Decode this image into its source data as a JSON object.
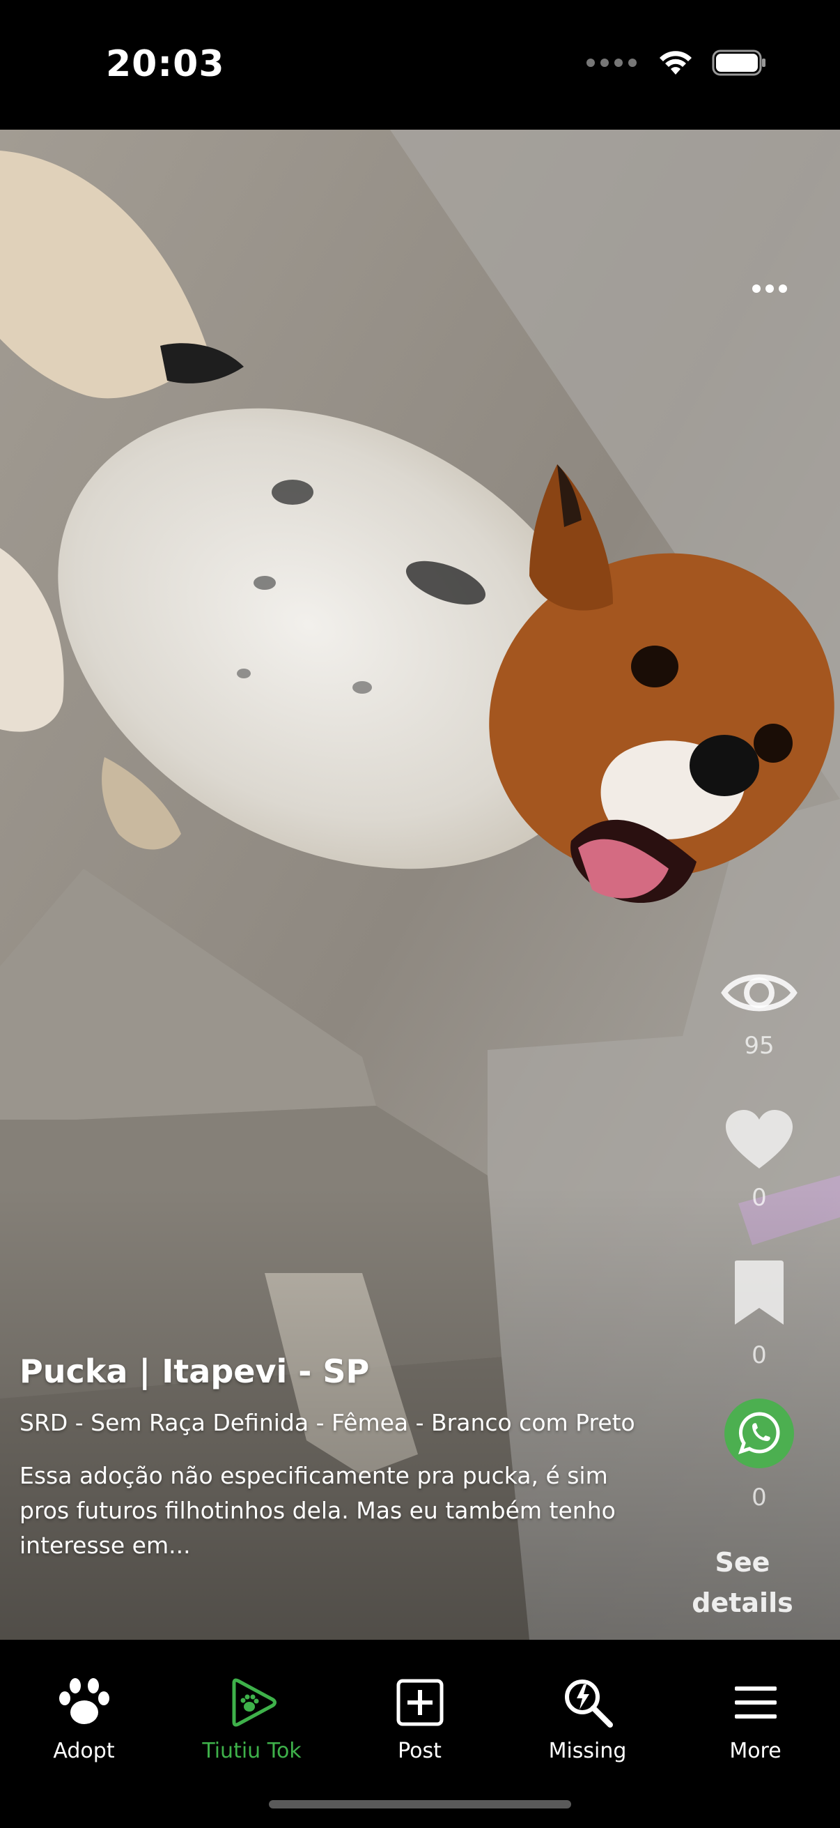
{
  "status_bar": {
    "time": "20:03",
    "icons": [
      "signal-dots-icon",
      "wifi-icon",
      "battery-icon"
    ]
  },
  "post": {
    "title": "Pucka | Itapevi - SP",
    "subtitle": "SRD - Sem Raça Definida - Fêmea - Branco com Preto",
    "description": "Essa adoção não especificamente pra pucka, é sim pros futuros filhotinhos dela. Mas eu também tenho interesse em..."
  },
  "actions": {
    "views": "95",
    "likes": "0",
    "saves": "0",
    "whatsapp": "0",
    "see_details": "See details"
  },
  "nav": {
    "items": [
      {
        "label": "Adopt",
        "icon": "paw-icon",
        "active": false
      },
      {
        "label": "Tiutiu Tok",
        "icon": "play-paw-icon",
        "active": true
      },
      {
        "label": "Post",
        "icon": "plus-square-icon",
        "active": false
      },
      {
        "label": "Missing",
        "icon": "search-lightning-icon",
        "active": false
      },
      {
        "label": "More",
        "icon": "menu-icon",
        "active": false
      }
    ]
  },
  "colors": {
    "accent": "#3eb14a",
    "whatsapp": "#4caf50",
    "background": "#000000"
  }
}
